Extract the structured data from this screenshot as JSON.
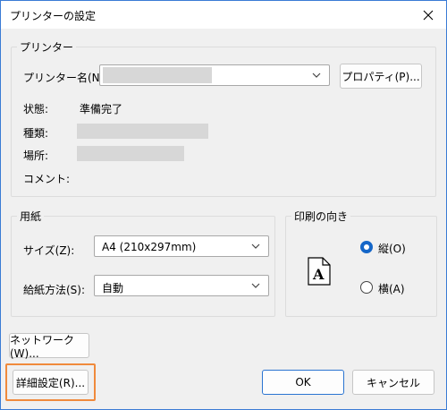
{
  "window": {
    "title": "プリンターの設定"
  },
  "printer_group": {
    "label": "プリンター",
    "name_label": "プリンター名(N):",
    "properties_button": "プロパティ(P)...",
    "status_label": "状態:",
    "status_value": "準備完了",
    "type_label": "種類:",
    "location_label": "場所:",
    "comment_label": "コメント:"
  },
  "paper_group": {
    "label": "用紙",
    "size_label": "サイズ(Z):",
    "size_value": "A4 (210x297mm)",
    "source_label": "給紙方法(S):",
    "source_value": "自動"
  },
  "orientation_group": {
    "label": "印刷の向き",
    "portrait_label": "縦(O)",
    "landscape_label": "横(A)",
    "selected": "portrait",
    "icon_letter": "A"
  },
  "buttons": {
    "network": "ネットワーク(W)...",
    "advanced": "詳細設定(R)...",
    "ok": "OK",
    "cancel": "キャンセル"
  },
  "colors": {
    "accent": "#1466c8",
    "highlight": "#f08a3c",
    "redaction": "#d7d7d7"
  }
}
